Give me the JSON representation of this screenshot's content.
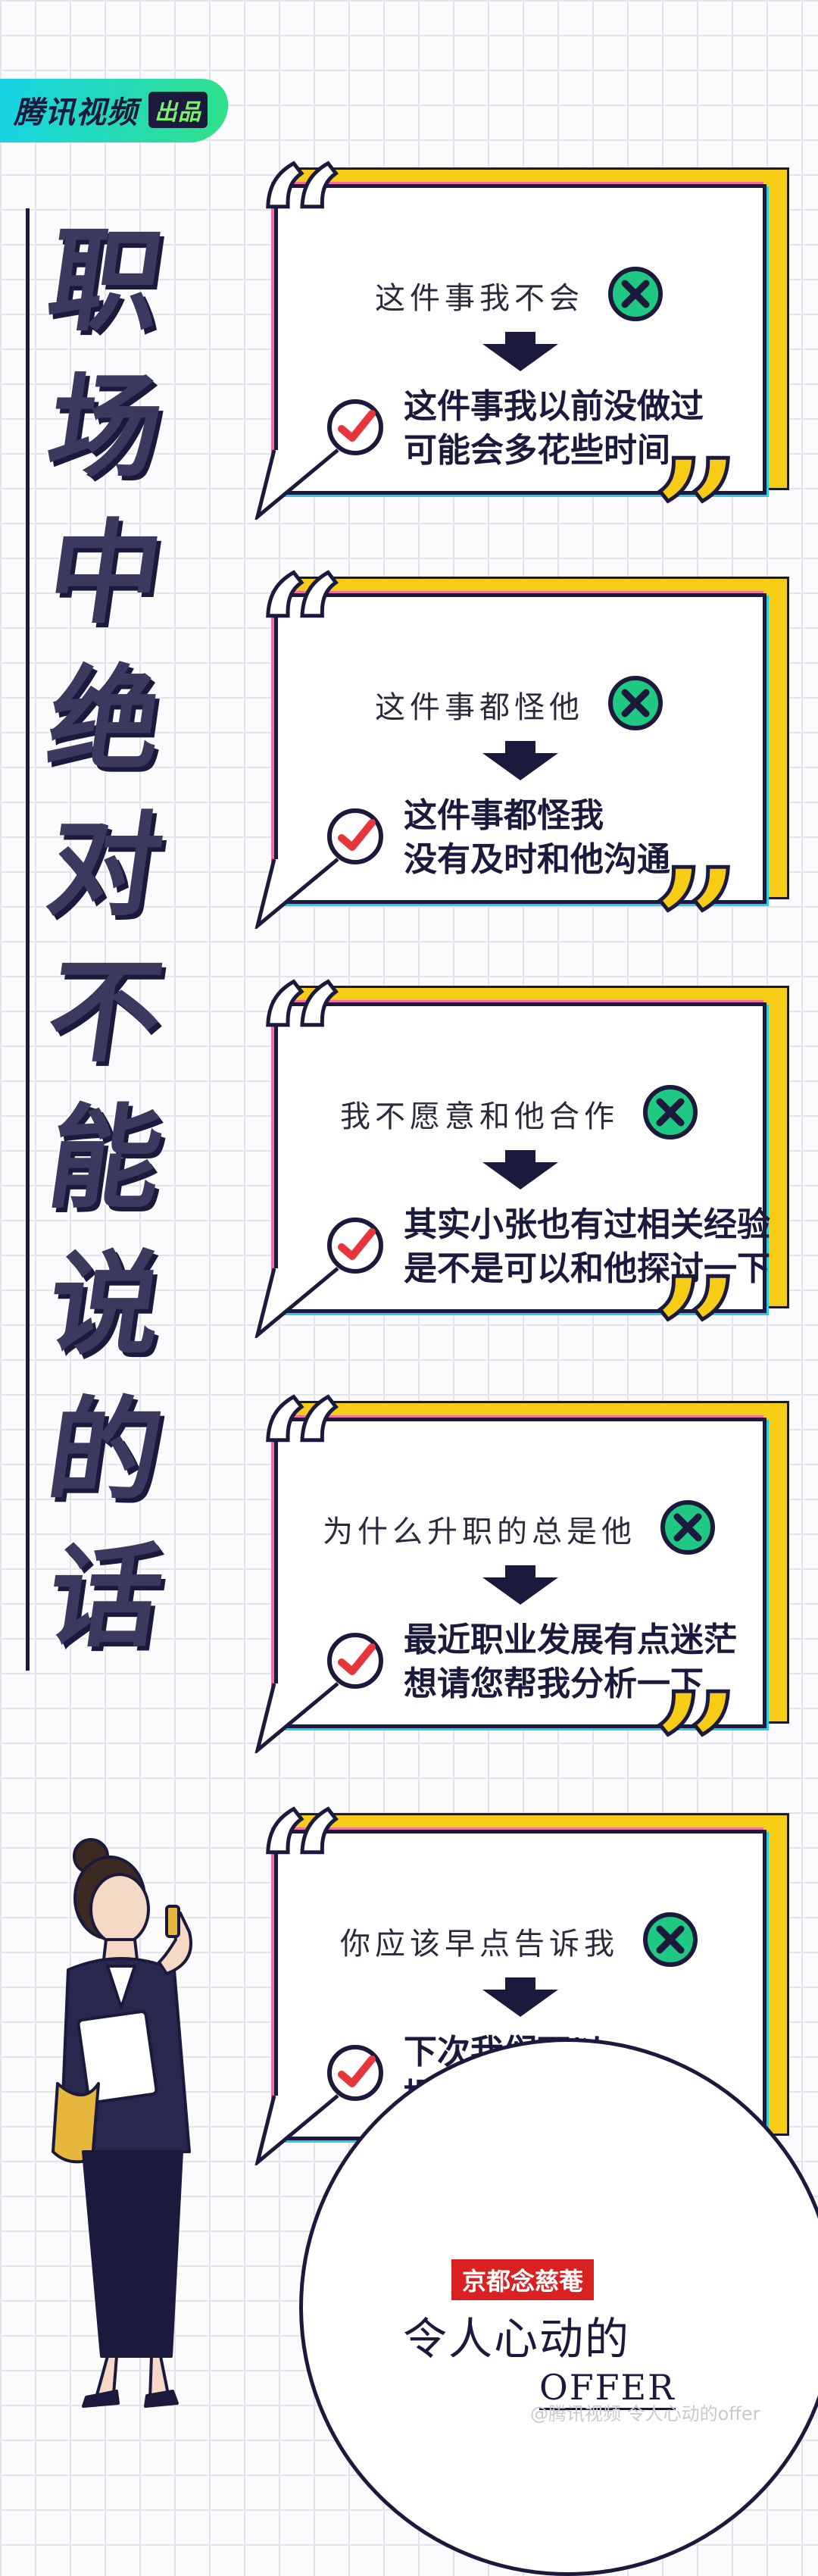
{
  "brand": {
    "name": "腾讯视频",
    "tag": "出品"
  },
  "title_chars": [
    "职",
    "场",
    "中",
    "绝",
    "对",
    "不",
    "能",
    "说",
    "的",
    "话"
  ],
  "cards": [
    {
      "wrong": "这件事我不会",
      "right": [
        "这件事我以前没做过",
        "可能会多花些时间"
      ]
    },
    {
      "wrong": "这件事都怪他",
      "right": [
        "这件事都怪我",
        "没有及时和他沟通"
      ]
    },
    {
      "wrong": "我不愿意和他合作",
      "right": [
        "其实小张也有过相关经验",
        "是不是可以和他探讨一下"
      ]
    },
    {
      "wrong": "为什么升职的总是他",
      "right": [
        "最近职业发展有点迷茫",
        "想请您帮我分析一下"
      ]
    },
    {
      "wrong": "你应该早点告诉我",
      "right": [
        "下次我们可以",
        "提前沟通一下"
      ]
    }
  ],
  "show": {
    "tag": "京都念慈菴",
    "title": "令人心动的",
    "offer": "OFFER"
  },
  "watermark": "@腾讯视频 令人心动的offer",
  "colors": {
    "navy": "#1b1a3c",
    "yellow": "#f7cc16",
    "red": "#e8353b",
    "green": "#1fc883"
  }
}
